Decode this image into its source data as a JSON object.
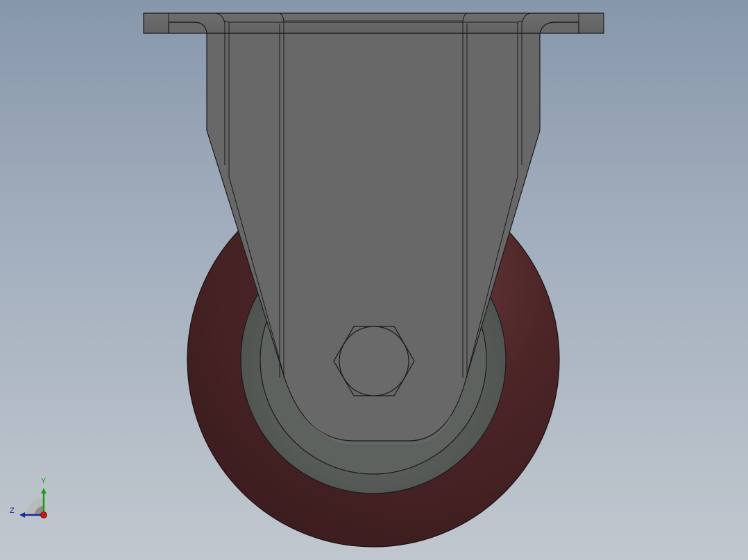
{
  "viewport": {
    "background_top": "#8797ab",
    "background_bottom": "#c1c7ce"
  },
  "model": {
    "bracket_color": "#686868",
    "bracket_edge_color": "#1a1a1a",
    "wheel_tread_color": "#4a2426",
    "wheel_hub_color": "#565a56",
    "axle_nut_shape": "hexagon"
  },
  "triad": {
    "y_label": "Y",
    "z_label": "Z",
    "y_color": "#1a9a1a",
    "z_color": "#1a2a9a",
    "x_color": "#c01818"
  }
}
